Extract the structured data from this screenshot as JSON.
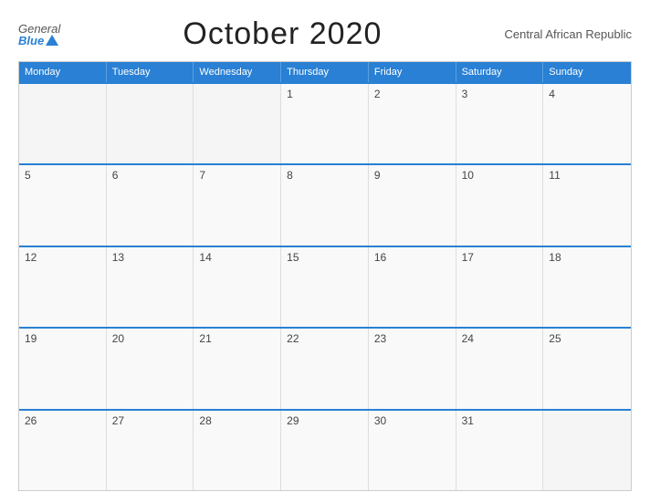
{
  "header": {
    "logo_general": "General",
    "logo_blue": "Blue",
    "title": "October 2020",
    "subtitle": "Central African Republic"
  },
  "calendar": {
    "days_of_week": [
      "Monday",
      "Tuesday",
      "Wednesday",
      "Thursday",
      "Friday",
      "Saturday",
      "Sunday"
    ],
    "weeks": [
      [
        "",
        "",
        "",
        "1",
        "2",
        "3",
        "4"
      ],
      [
        "5",
        "6",
        "7",
        "8",
        "9",
        "10",
        "11"
      ],
      [
        "12",
        "13",
        "14",
        "15",
        "16",
        "17",
        "18"
      ],
      [
        "19",
        "20",
        "21",
        "22",
        "23",
        "24",
        "25"
      ],
      [
        "26",
        "27",
        "28",
        "29",
        "30",
        "31",
        ""
      ]
    ]
  }
}
